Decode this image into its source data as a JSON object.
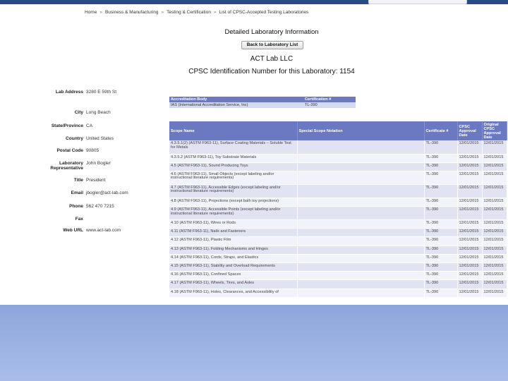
{
  "breadcrumb": {
    "items": [
      "Home",
      "Business & Manufacturing",
      "Testing & Certification",
      "List of CPSC-Accepted Testing Laboratories"
    ],
    "separator": "»"
  },
  "page": {
    "heading": "Detailed Laboratory Information",
    "back_button": "Back to Laboratory List",
    "lab_name": "ACT Lab LLC",
    "cpsc_id_line": "CPSC Identification Number for this Laboratory: 1154"
  },
  "lab_info": [
    {
      "label": "Lab Address",
      "value": "3280 E 59th St"
    },
    {
      "label": "City",
      "value": "Long Beach"
    },
    {
      "label": "State/Province",
      "value": "CA"
    },
    {
      "label": "Country",
      "value": "United States"
    },
    {
      "label": "Postal Code",
      "value": "90805"
    },
    {
      "label": "Laboratory Representative",
      "value": "John Bogler"
    },
    {
      "label": "Title",
      "value": "President"
    },
    {
      "label": "Email",
      "value": "jbogler@act-lab.com"
    },
    {
      "label": "Phone",
      "value": "562 470 7215"
    },
    {
      "label": "Fax",
      "value": ""
    },
    {
      "label": "Web URL",
      "value": "www.act-lab.com"
    }
  ],
  "accreditation": {
    "headers": [
      "Accreditation Body",
      "Certification #"
    ],
    "rows": [
      [
        "IAS (International Accreditation Service, Inc)",
        "TL-390"
      ]
    ]
  },
  "scope": {
    "headers": [
      "Scope Name",
      "Special Scope Notation",
      "Certificate #",
      "CPSC Approval Date",
      "Original CPSC Approval Date"
    ],
    "rows": [
      [
        "4.3.5.1(2) (ASTM F963-11), Surface Coating Materials – Soluble Test for Metals",
        "",
        "TL-390",
        "12/01/2015",
        "12/01/2015"
      ],
      [
        "4.3.5.2 (ASTM F963-11), Toy Substrate Materials",
        "",
        "TL-390",
        "12/01/2015",
        "12/01/2015"
      ],
      [
        "4.5 (ASTM F963-11), Sound Producing Toys",
        "",
        "TL-390",
        "12/01/2015",
        "12/01/2015"
      ],
      [
        "4.6 (ASTM F963-11), Small Objects (except labeling and/or instructional literature requirements)",
        "",
        "TL-390",
        "12/01/2015",
        "12/01/2015"
      ],
      [
        "4.7 (ASTM F963-11), Accessible Edges (except labeling and/or instructional literature requirements)",
        "",
        "TL-390",
        "12/01/2015",
        "12/01/2015"
      ],
      [
        "4.8 (ASTM F963-11), Projections (except bath toy projections)",
        "",
        "TL-390",
        "12/01/2015",
        "12/01/2015"
      ],
      [
        "4.9 (ASTM F963-11), Accessible Points (except labeling and/or instructional literature requirements)",
        "",
        "TL-390",
        "12/01/2015",
        "12/01/2015"
      ],
      [
        "4.10 (ASTM F963-11), Wires or Rods",
        "",
        "TL-390",
        "12/01/2015",
        "12/01/2015"
      ],
      [
        "4.11 (ASTM F963-11), Nails and Fasteners",
        "",
        "TL-390",
        "12/01/2015",
        "12/01/2015"
      ],
      [
        "4.12 (ASTM F963-11), Plastic Film",
        "",
        "TL-390",
        "12/01/2015",
        "12/01/2015"
      ],
      [
        "4.13 (ASTM F963-11), Folding Mechanisms and Hinges",
        "",
        "TL-390",
        "12/01/2015",
        "12/01/2015"
      ],
      [
        "4.14 (ASTM F963-11), Cords, Straps, and Elastics",
        "",
        "TL-390",
        "12/01/2015",
        "12/01/2015"
      ],
      [
        "4.15 (ASTM F963-11), Stability and Overload Requirements",
        "",
        "TL-390",
        "12/01/2015",
        "12/01/2015"
      ],
      [
        "4.16 (ASTM F963-11), Confined Spaces",
        "",
        "TL-390",
        "12/01/2015",
        "12/01/2015"
      ],
      [
        "4.17 (ASTM F963-11), Wheels, Tires, and Axles",
        "",
        "TL-390",
        "12/01/2015",
        "12/01/2015"
      ],
      [
        "4.18 (ASTM F963-11), Holes, Clearances, and Accessibility of",
        "",
        "TL-390",
        "12/01/2015",
        "12/01/2015"
      ]
    ]
  },
  "colors": {
    "topbar": "#2c4a86",
    "table_header": "#6b78c2",
    "row_odd": "#e0e3f2",
    "row_even": "#f2f3fa",
    "overlay": "#8ea6da"
  }
}
